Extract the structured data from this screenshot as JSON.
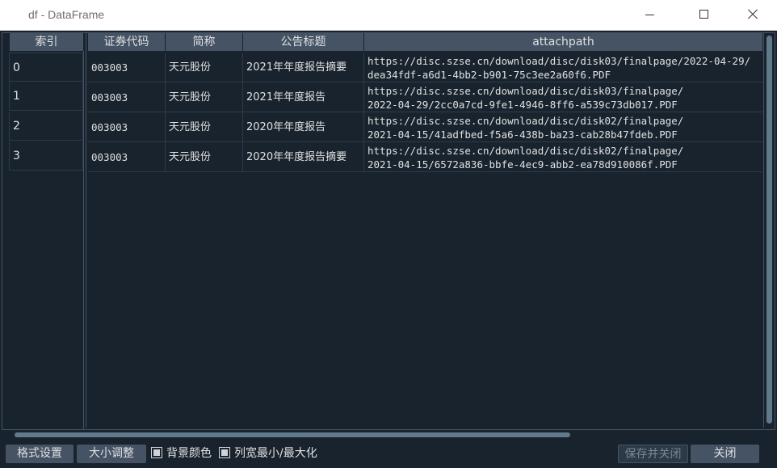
{
  "window": {
    "title": "df - DataFrame"
  },
  "index_header": "索引",
  "columns": [
    "证券代码",
    "简称",
    "公告标题",
    "attachpath"
  ],
  "index": [
    "0",
    "1",
    "2",
    "3"
  ],
  "rows": [
    {
      "code": "003003",
      "name": "天元股份",
      "title": "2021年年度报告摘要",
      "path_line1": "https://disc.szse.cn/download/disc/disk03/finalpage/2022-04-29/",
      "path_line2": "dea34fdf-a6d1-4bb2-b901-75c3ee2a60f6.PDF"
    },
    {
      "code": "003003",
      "name": "天元股份",
      "title": "2021年年度报告",
      "path_line1": "https://disc.szse.cn/download/disc/disk03/finalpage/",
      "path_line2": "2022-04-29/2cc0a7cd-9fe1-4946-8ff6-a539c73db017.PDF"
    },
    {
      "code": "003003",
      "name": "天元股份",
      "title": "2020年年度报告",
      "path_line1": "https://disc.szse.cn/download/disc/disk02/finalpage/",
      "path_line2": "2021-04-15/41adfbed-f5a6-438b-ba23-cab28b47fdeb.PDF"
    },
    {
      "code": "003003",
      "name": "天元股份",
      "title": "2020年年度报告摘要",
      "path_line1": "https://disc.szse.cn/download/disc/disk02/finalpage/",
      "path_line2": "2021-04-15/6572a836-bbfe-4ec9-abb2-ea78d910086f.PDF"
    }
  ],
  "toolbar": {
    "format_button": "格式设置",
    "resize_button": "大小调整",
    "bg_color_label": "背景颜色",
    "col_width_label": "列宽最小/最大化",
    "save_close_button": "保存并关闭",
    "close_button": "关闭"
  },
  "colors": {
    "background": "#19232d",
    "header": "#455364",
    "scroll_thumb": "#60798b"
  }
}
